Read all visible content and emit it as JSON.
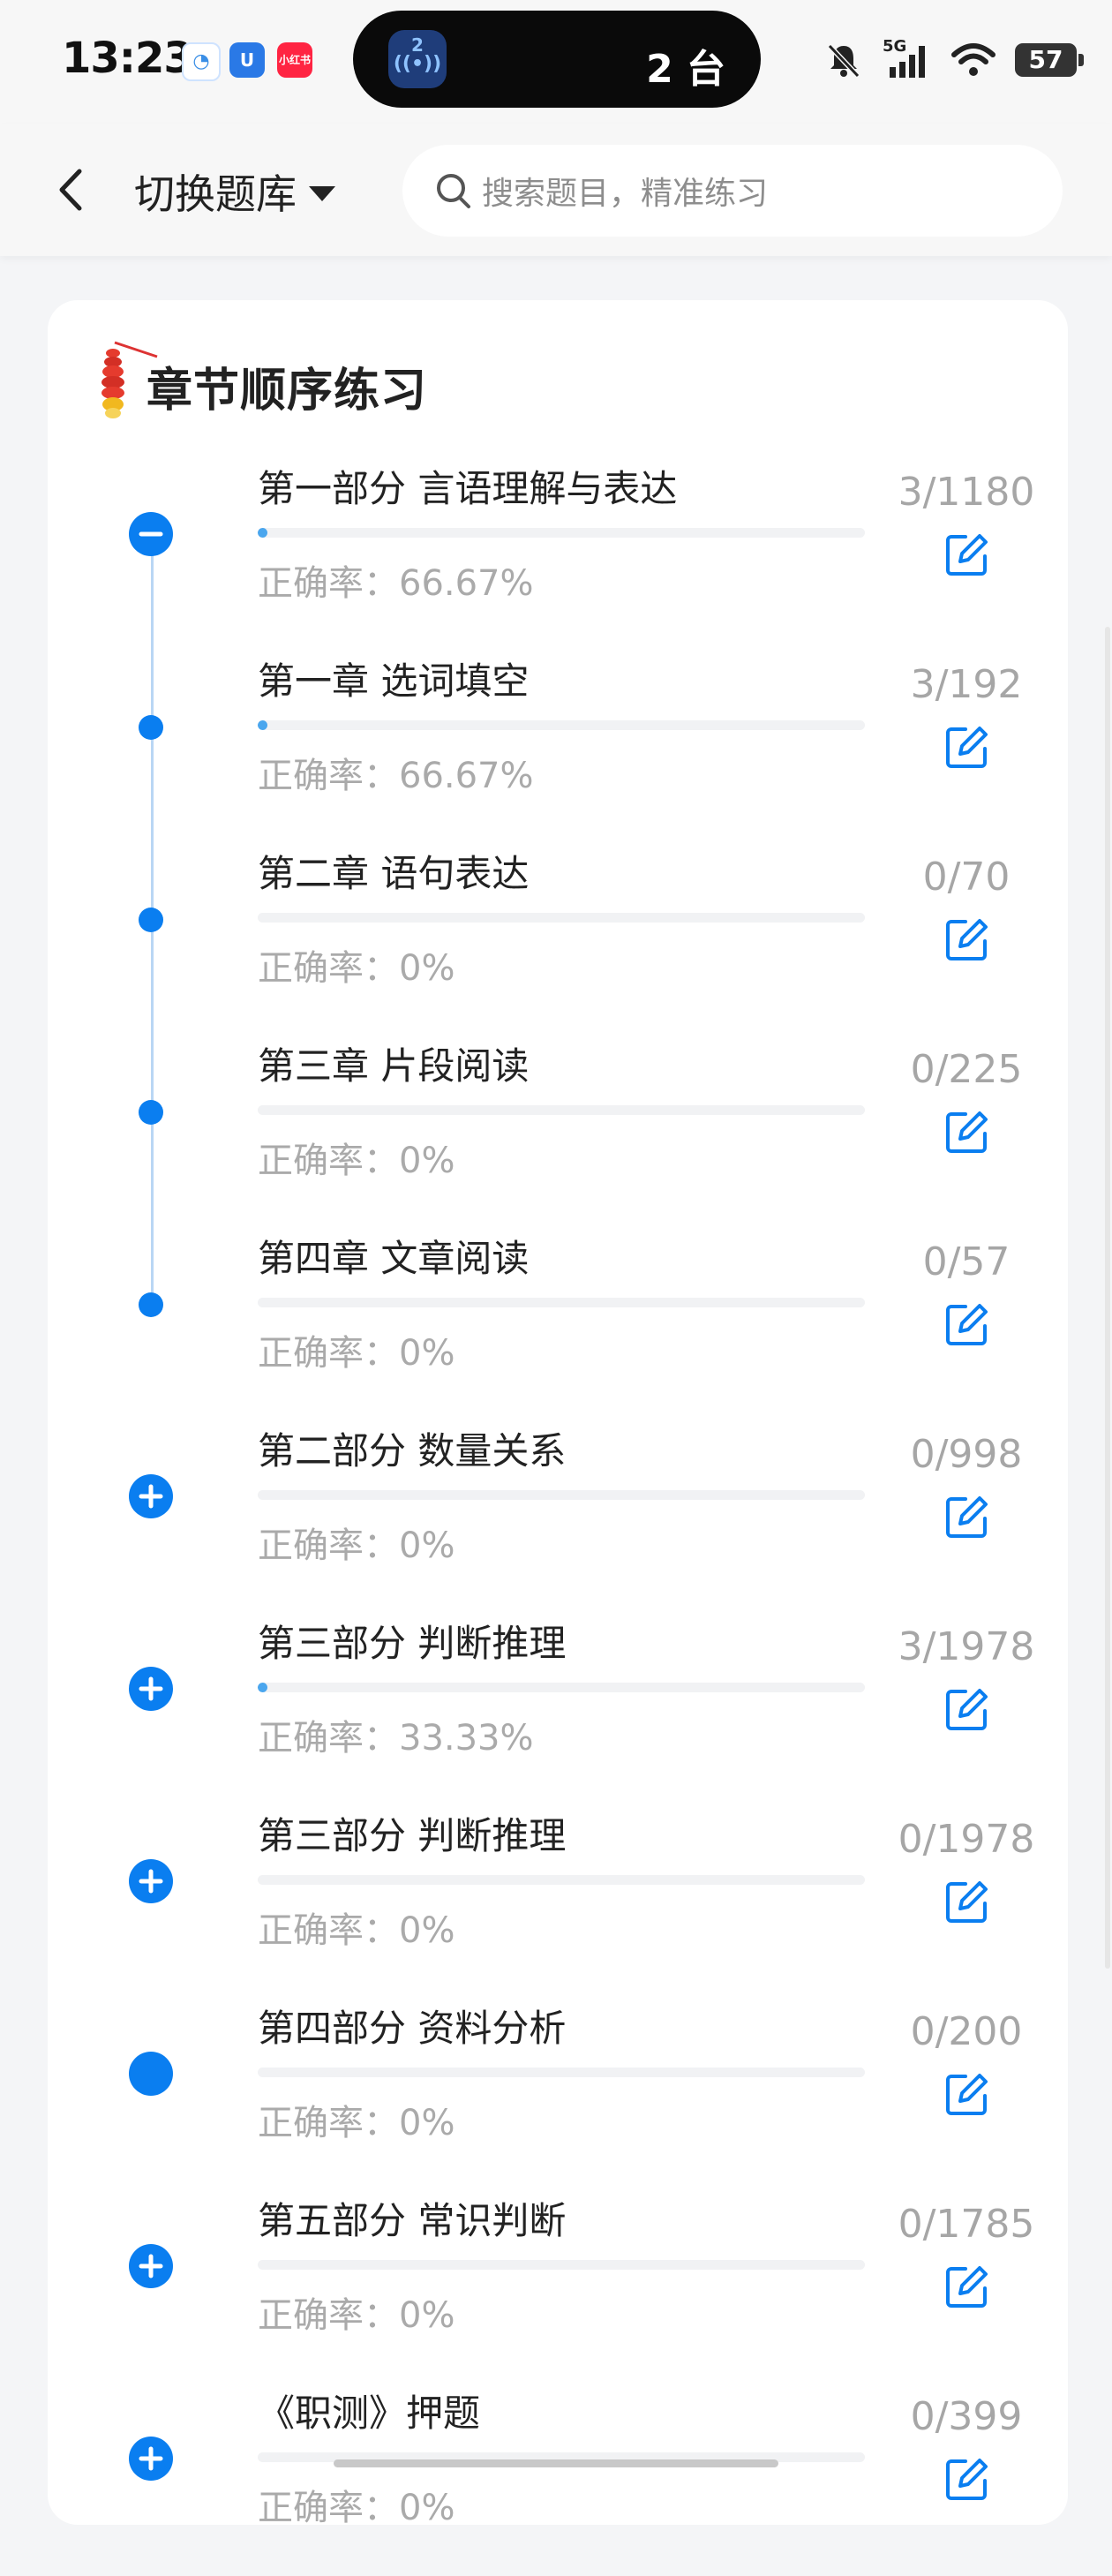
{
  "status_bar": {
    "time": "13:23",
    "app_icons": [
      {
        "icon": "chat-bubble-icon",
        "label": "",
        "color": "#ffffff"
      },
      {
        "icon": "u-app-icon",
        "label": "U",
        "color": "#2a79e6"
      },
      {
        "icon": "xiaohongshu-icon",
        "label": "小红书",
        "color": "#ff2442"
      }
    ],
    "island_badge": "2",
    "island_text": "2 台",
    "network": "5G",
    "battery": "57"
  },
  "nav": {
    "bank_switch_label": "切换题库",
    "search_placeholder": "搜索题目，精准练习"
  },
  "section": {
    "title": "章节顺序练习"
  },
  "colors": {
    "accent": "#0a7ef0",
    "progress": "#4aa6ee",
    "muted_text": "#aaaaaa"
  },
  "items": [
    {
      "title": "第一部分 言语理解与表达",
      "accuracy": "正确率：66.67%",
      "count": "3/1180",
      "node": "minus",
      "progress": 0.0025
    },
    {
      "title": "第一章 选词填空",
      "accuracy": "正确率：66.67%",
      "count": "3/192",
      "node": "dot",
      "progress": 0.0156
    },
    {
      "title": "第二章 语句表达",
      "accuracy": "正确率：0%",
      "count": "0/70",
      "node": "dot",
      "progress": 0
    },
    {
      "title": "第三章 片段阅读",
      "accuracy": "正确率：0%",
      "count": "0/225",
      "node": "dot",
      "progress": 0
    },
    {
      "title": "第四章 文章阅读",
      "accuracy": "正确率：0%",
      "count": "0/57",
      "node": "dot",
      "progress": 0
    },
    {
      "title": "第二部分 数量关系",
      "accuracy": "正确率：0%",
      "count": "0/998",
      "node": "plus",
      "progress": 0
    },
    {
      "title": "第三部分 判断推理",
      "accuracy": "正确率：33.33%",
      "count": "3/1978",
      "node": "plus",
      "progress": 0.0015
    },
    {
      "title": "第三部分 判断推理",
      "accuracy": "正确率：0%",
      "count": "0/1978",
      "node": "plus",
      "progress": 0
    },
    {
      "title": "第四部分 资料分析",
      "accuracy": "正确率：0%",
      "count": "0/200",
      "node": "filled",
      "progress": 0
    },
    {
      "title": "第五部分 常识判断",
      "accuracy": "正确率：0%",
      "count": "0/1785",
      "node": "plus",
      "progress": 0
    },
    {
      "title": "《职测》押题",
      "accuracy": "正确率：0%",
      "count": "0/399",
      "node": "plus",
      "progress": 0
    }
  ]
}
